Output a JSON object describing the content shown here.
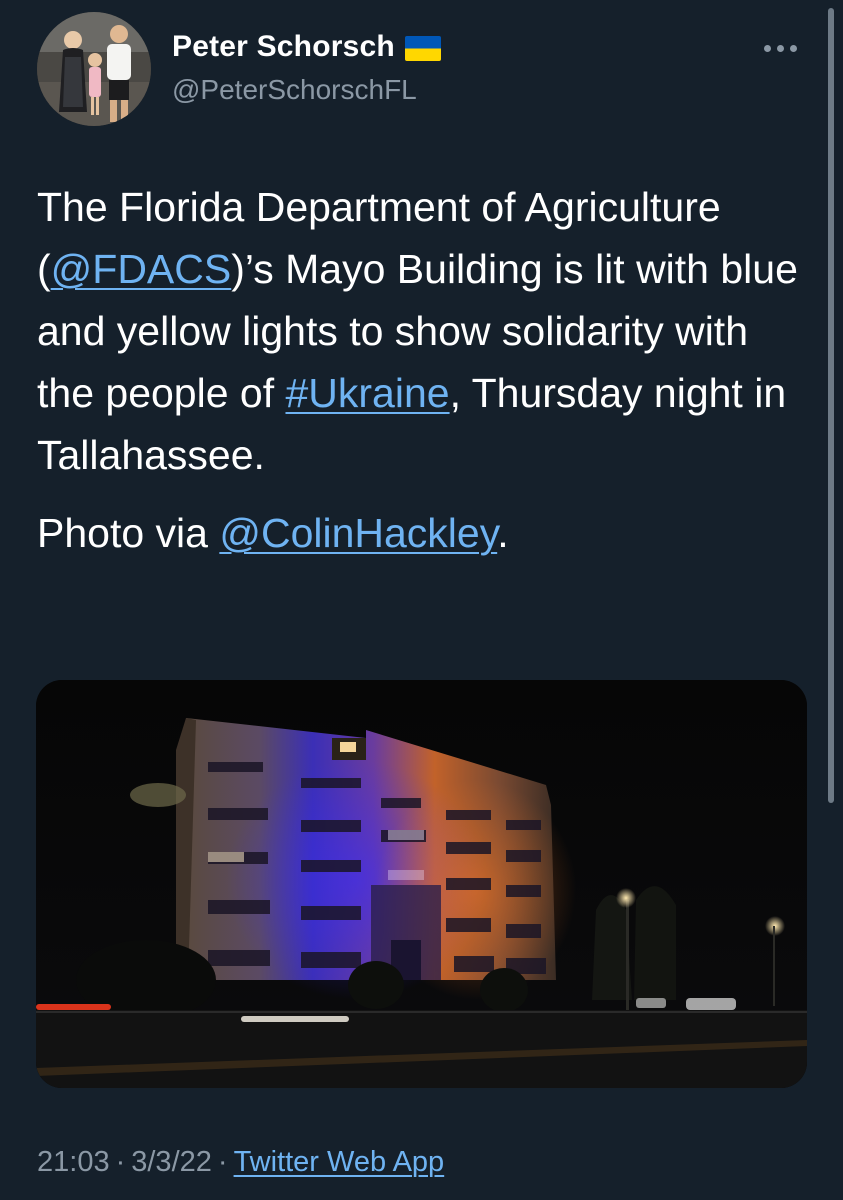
{
  "author": {
    "display_name": "Peter Schorsch",
    "handle": "@PeterSchorschFL",
    "badge_icon": "ukraine-flag-icon",
    "avatar_icon": "profile-photo"
  },
  "menu": {
    "more_icon": "more-horizontal-icon"
  },
  "tweet": {
    "line1_text": "The Florida Department of Agriculture (",
    "mention_fdacs": "@FDACS",
    "line1_after": ")’s Mayo Building is lit with blue and yellow lights to show solidarity with the people of ",
    "hashtag_ukraine": "#Ukraine",
    "line1_end": ", Thursday night in Tallahassee.",
    "line2_prefix": "Photo via ",
    "mention_colin": "@ColinHackley",
    "line2_end": "."
  },
  "media": {
    "icon": "photo-mayo-building-night"
  },
  "footer": {
    "time": "21:03",
    "date": "3/3/22",
    "separator": "·",
    "source": "Twitter Web App"
  },
  "colors": {
    "background": "#15202b",
    "primary_text": "#ffffff",
    "secondary_text": "#8b98a5",
    "link": "#6fb3f2",
    "flag_blue": "#0057b7",
    "flag_yellow": "#ffd700"
  }
}
